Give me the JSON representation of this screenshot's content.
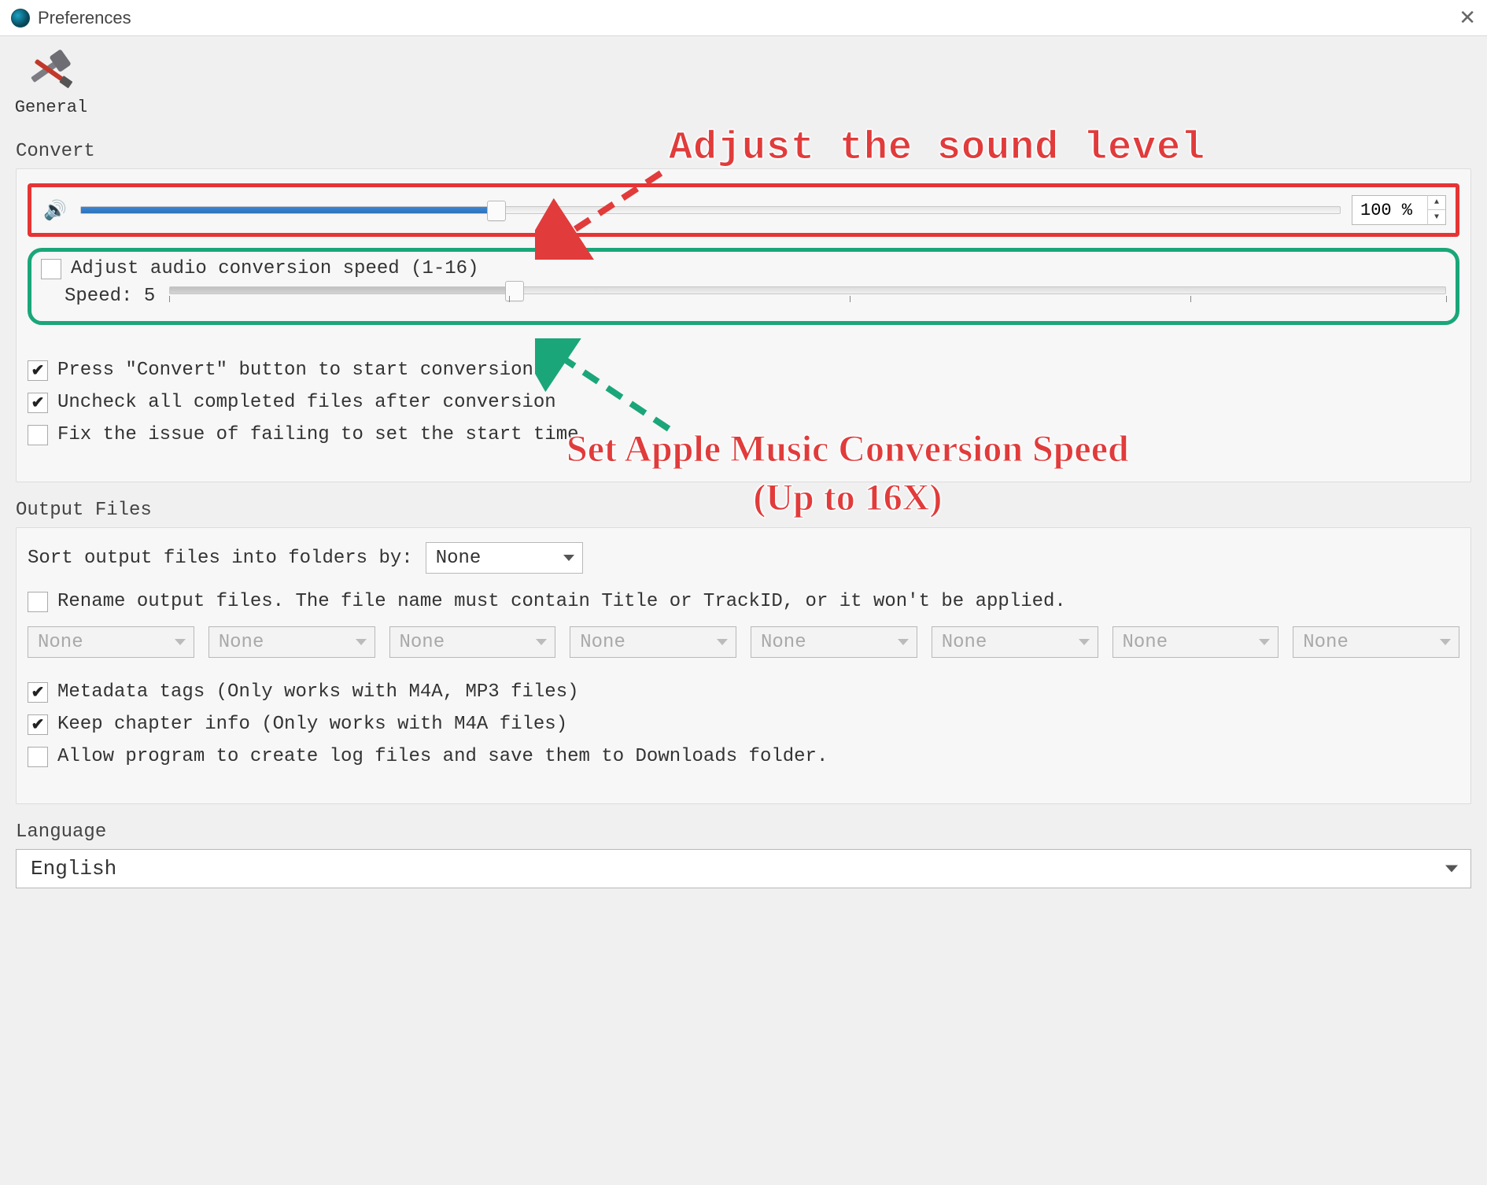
{
  "window": {
    "title": "Preferences"
  },
  "tabs": {
    "general": "General"
  },
  "sections": {
    "convert": "Convert",
    "output_files": "Output Files",
    "language": "Language"
  },
  "convert": {
    "volume_percent": "100 %",
    "volume_slider_pos_pct": 33,
    "speed_checkbox_label": "Adjust audio conversion speed (1-16)",
    "speed_checkbox_checked": false,
    "speed_label_prefix": "Speed: ",
    "speed_value": "5",
    "speed_slider_pos_pct": 27,
    "press_convert_label": "Press \"Convert\" button to start conversion",
    "press_convert_checked": true,
    "uncheck_completed_label": "Uncheck all completed files after conversion",
    "uncheck_completed_checked": true,
    "fix_start_time_label": "Fix the issue of failing to set the start time",
    "fix_start_time_checked": false
  },
  "output": {
    "sort_label": "Sort output files into folders by:",
    "sort_value": "None",
    "rename_label": "Rename output files. The file name must contain Title or TrackID, or it won't be applied.",
    "rename_checked": false,
    "rename_fields": [
      "None",
      "None",
      "None",
      "None",
      "None",
      "None",
      "None",
      "None"
    ],
    "metadata_label": "Metadata tags (Only works with M4A, MP3 files)",
    "metadata_checked": true,
    "chapter_label": "Keep chapter info (Only works with M4A files)",
    "chapter_checked": true,
    "log_label": "Allow program to create log files and save them to Downloads folder.",
    "log_checked": false
  },
  "language": {
    "value": "English"
  },
  "annotations": {
    "top": "Adjust the sound level",
    "mid_line1": "Set Apple Music Conversion Speed",
    "mid_line2": "(Up to 16X)"
  },
  "colors": {
    "callout_red": "#e63434",
    "callout_green": "#1aa679",
    "annotation_text": "#e13b3b",
    "slider_blue": "#3a87d6"
  }
}
